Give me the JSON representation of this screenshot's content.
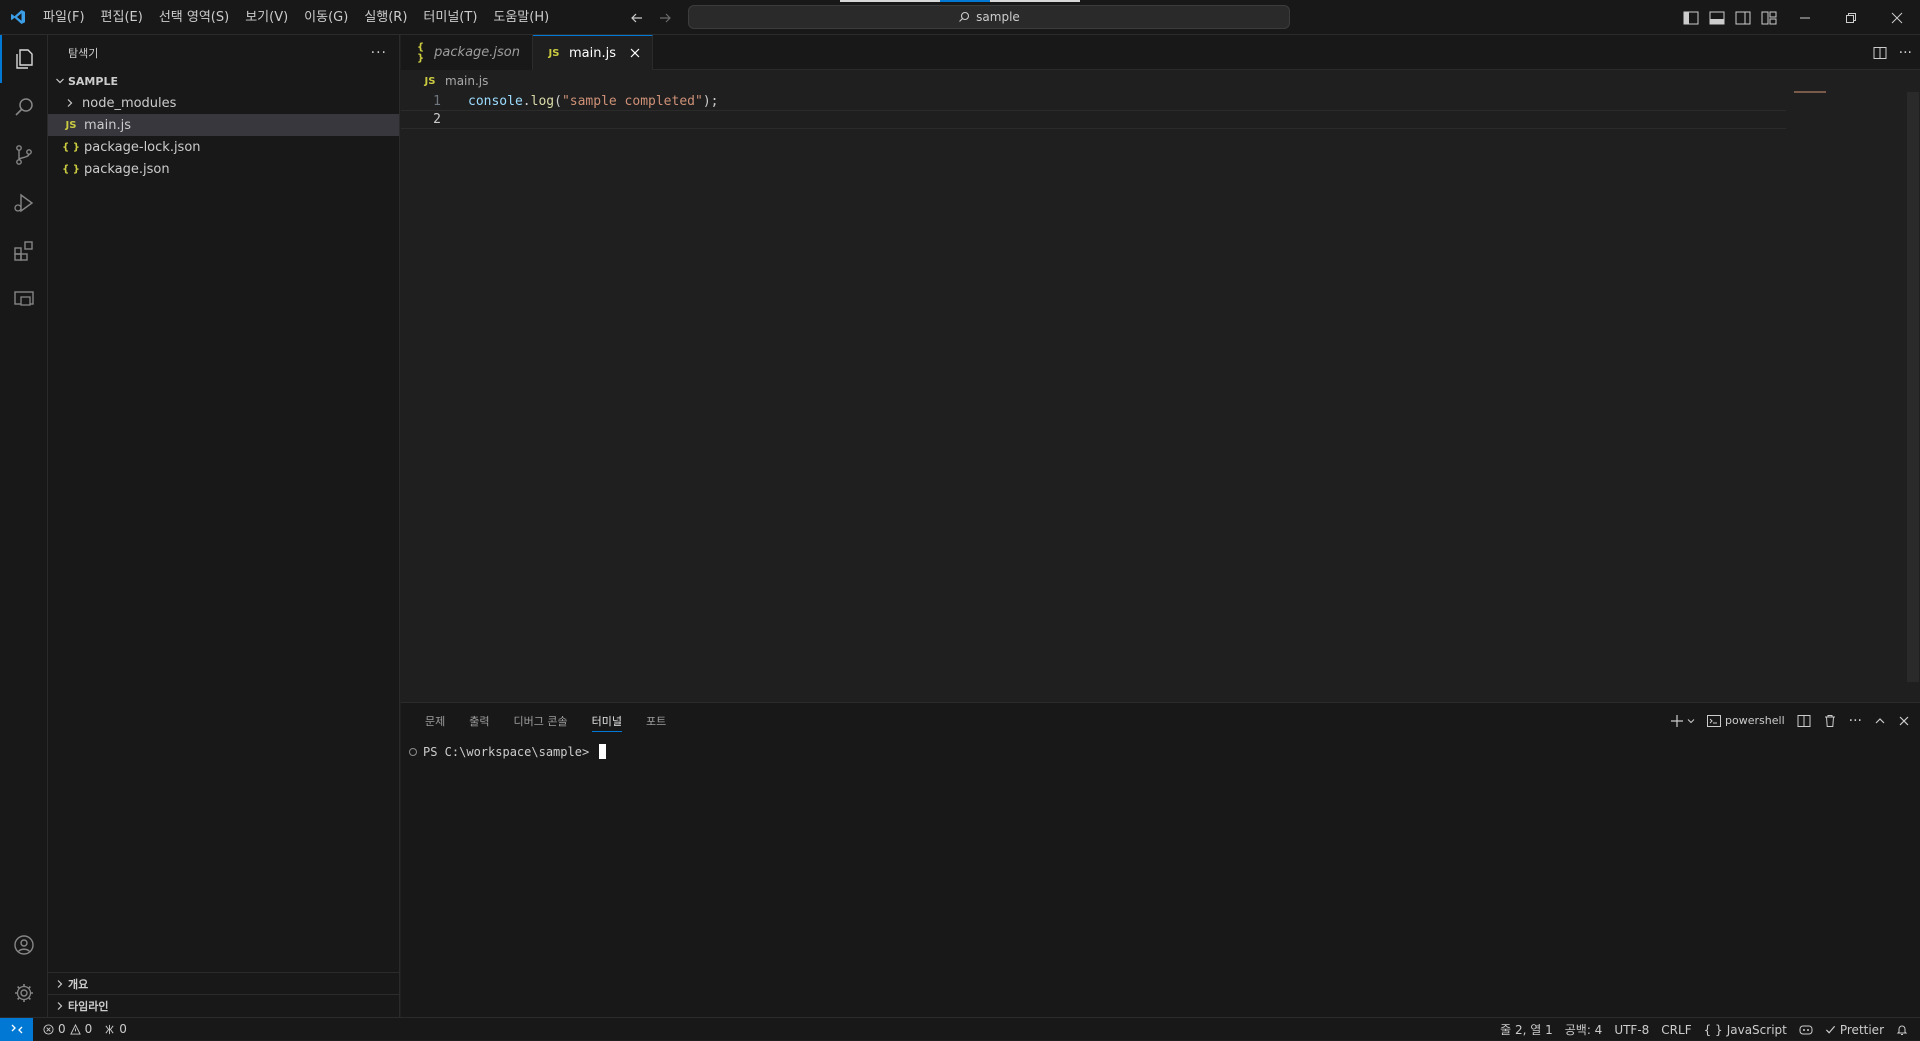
{
  "menu": [
    "파일(F)",
    "편집(E)",
    "선택 영역(S)",
    "보기(V)",
    "이동(G)",
    "실행(R)",
    "터미널(T)",
    "도움말(H)"
  ],
  "command_center": {
    "text": "sample"
  },
  "sidebar": {
    "title": "탐색기",
    "root": "SAMPLE",
    "tree": [
      {
        "label": "node_modules",
        "kind": "folder"
      },
      {
        "label": "main.js",
        "kind": "js"
      },
      {
        "label": "package-lock.json",
        "kind": "json"
      },
      {
        "label": "package.json",
        "kind": "json"
      }
    ],
    "outline": "개요",
    "timeline": "타임라인"
  },
  "tabs": [
    {
      "label": "package.json",
      "icon": "{ }"
    },
    {
      "label": "main.js",
      "icon": "JS"
    }
  ],
  "breadcrumb": {
    "file": "main.js",
    "icon": "JS"
  },
  "editor": {
    "lines": [
      {
        "num": "1",
        "tokens": [
          {
            "t": "console",
            "c": "tk-id"
          },
          {
            "t": ".",
            "c": "tk-p"
          },
          {
            "t": "log",
            "c": "tk-fn"
          },
          {
            "t": "(",
            "c": "tk-p"
          },
          {
            "t": "\"sample completed\"",
            "c": "tk-s"
          },
          {
            "t": ");",
            "c": "tk-p"
          }
        ]
      },
      {
        "num": "2",
        "tokens": []
      }
    ]
  },
  "panel": {
    "tabs": [
      "문제",
      "출력",
      "디버그 콘솔",
      "터미널",
      "포트"
    ],
    "active_tab": "터미널",
    "shell": "powershell",
    "prompt": "PS C:\\workspace\\sample>"
  },
  "status": {
    "errors": "0",
    "warnings": "0",
    "ports": "0",
    "position": "줄 2, 열 1",
    "spaces": "공백: 4",
    "encoding": "UTF-8",
    "eol": "CRLF",
    "language": "JavaScript",
    "formatter": "Prettier"
  },
  "colors": {
    "accent": "#0078d4",
    "string": "#ce9178",
    "identifier": "#9cdcfe",
    "function": "#dcdcaa"
  }
}
